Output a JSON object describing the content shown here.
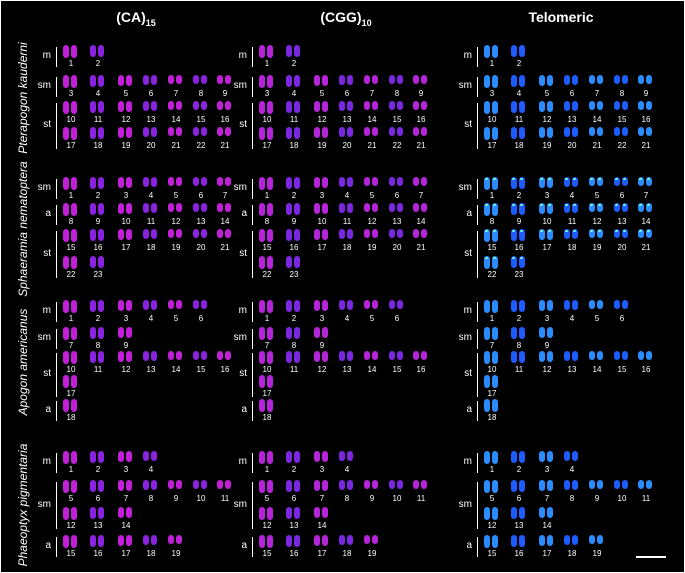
{
  "columns": [
    {
      "title": "(CA)",
      "sub": "15",
      "color": "#8a22e0",
      "color2": "#c21fd8"
    },
    {
      "title": "(CGG)",
      "sub": "10",
      "color": "#7a28e0",
      "color2": "#b524d8"
    },
    {
      "title": "Telomeric",
      "sub": "",
      "color": "#1d5cff",
      "color2": "#2a8cff"
    }
  ],
  "species": [
    {
      "name": "Pterapogon kauderni",
      "groups": [
        {
          "label": "m",
          "rows": [
            [
              "1",
              "2"
            ]
          ]
        },
        {
          "label": "sm",
          "rows": [
            [
              "3",
              "4",
              "5",
              "6",
              "7",
              "8",
              "9"
            ]
          ]
        },
        {
          "label": "st",
          "rows": [
            [
              "10",
              "11",
              "12",
              "13",
              "14",
              "15",
              "16"
            ],
            [
              "17",
              "18",
              "19",
              "20",
              "21",
              "22",
              "21"
            ]
          ]
        }
      ]
    },
    {
      "name": "Sphaeramia nematoptera",
      "groups": [
        {
          "label": "sm",
          "rows": [
            [
              "1",
              "2",
              "3",
              "4",
              "5",
              "6",
              "7"
            ]
          ]
        },
        {
          "label": "a",
          "rows": [
            [
              "8",
              "9",
              "10",
              "11",
              "12",
              "13",
              "14"
            ]
          ]
        },
        {
          "label": "st",
          "rows": [
            [
              "15",
              "16",
              "17",
              "18",
              "19",
              "20",
              "21"
            ],
            [
              "22",
              "23"
            ]
          ]
        }
      ]
    },
    {
      "name": "Apogon americanus",
      "groups": [
        {
          "label": "m",
          "rows": [
            [
              "1",
              "2",
              "3",
              "4",
              "5",
              "6"
            ]
          ]
        },
        {
          "label": "sm",
          "rows": [
            [
              "7",
              "8",
              "9"
            ]
          ]
        },
        {
          "label": "st",
          "rows": [
            [
              "10",
              "11",
              "12",
              "13",
              "14",
              "15",
              "16"
            ],
            [
              "17"
            ]
          ]
        },
        {
          "label": "a",
          "rows": [
            [
              "18"
            ]
          ]
        }
      ]
    },
    {
      "name": "Phaeoptyx pigmentaria",
      "groups": [
        {
          "label": "m",
          "rows": [
            [
              "1",
              "2",
              "3",
              "4"
            ]
          ]
        },
        {
          "label": "sm",
          "rows": [
            [
              "5",
              "6",
              "7",
              "8",
              "9",
              "10",
              "11"
            ],
            [
              "12",
              "13",
              "14"
            ]
          ]
        },
        {
          "label": "a",
          "rows": [
            [
              "15",
              "16",
              "17",
              "18",
              "19"
            ]
          ]
        }
      ]
    }
  ]
}
